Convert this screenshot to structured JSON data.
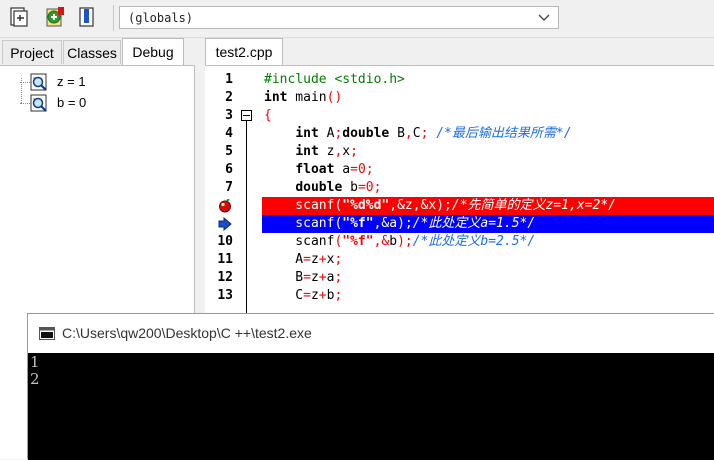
{
  "toolbar": {
    "buttons": [
      {
        "name": "insert-icon"
      },
      {
        "name": "toggle-bookmark-icon"
      },
      {
        "name": "goto-bookmark-icon"
      }
    ],
    "scope_combo": {
      "value": "(globals)"
    }
  },
  "left_panel": {
    "tabs": [
      "Project",
      "Classes",
      "Debug"
    ],
    "active_tab": "Debug",
    "watches": [
      {
        "label": "z = 1"
      },
      {
        "label": "b = 0"
      }
    ]
  },
  "editor": {
    "tab": "test2.cpp",
    "line_numbers": [
      "1",
      "2",
      "3",
      "4",
      "5",
      "6",
      "7",
      "8",
      "9",
      "10",
      "11",
      "12",
      "13"
    ],
    "lines": [
      [
        {
          "c": "pp",
          "t": "#include <stdio.h>"
        }
      ],
      [
        {
          "c": "kw",
          "t": "int"
        },
        {
          "c": "",
          "t": " main"
        },
        {
          "c": "sym",
          "t": "()"
        }
      ],
      [
        {
          "c": "sym",
          "t": "{"
        }
      ],
      [
        {
          "c": "",
          "t": "    "
        },
        {
          "c": "kw",
          "t": "int"
        },
        {
          "c": "",
          "t": " A"
        },
        {
          "c": "sym",
          "t": ";"
        },
        {
          "c": "kw",
          "t": "double"
        },
        {
          "c": "",
          "t": " B"
        },
        {
          "c": "sym",
          "t": ","
        },
        {
          "c": "",
          "t": "C"
        },
        {
          "c": "sym",
          "t": ";"
        },
        {
          "c": "",
          "t": " "
        },
        {
          "c": "cm",
          "t": "/*最后输出结果所需*/"
        }
      ],
      [
        {
          "c": "",
          "t": "    "
        },
        {
          "c": "kw",
          "t": "int"
        },
        {
          "c": "",
          "t": " z"
        },
        {
          "c": "sym",
          "t": ","
        },
        {
          "c": "",
          "t": "x"
        },
        {
          "c": "sym",
          "t": ";"
        }
      ],
      [
        {
          "c": "",
          "t": "    "
        },
        {
          "c": "kw",
          "t": "float"
        },
        {
          "c": "",
          "t": " a"
        },
        {
          "c": "sym",
          "t": "="
        },
        {
          "c": "num",
          "t": "0"
        },
        {
          "c": "sym",
          "t": ";"
        }
      ],
      [
        {
          "c": "",
          "t": "    "
        },
        {
          "c": "kw",
          "t": "double"
        },
        {
          "c": "",
          "t": " b"
        },
        {
          "c": "sym",
          "t": "="
        },
        {
          "c": "num",
          "t": "0"
        },
        {
          "c": "sym",
          "t": ";"
        }
      ],
      [
        {
          "c": "",
          "t": "    scanf"
        },
        {
          "c": "sym",
          "t": "("
        },
        {
          "c": "str",
          "t": "\"%d%d\""
        },
        {
          "c": "sym",
          "t": ",&"
        },
        {
          "c": "",
          "t": "z"
        },
        {
          "c": "sym",
          "t": ",&"
        },
        {
          "c": "",
          "t": "x"
        },
        {
          "c": "sym",
          "t": ");"
        },
        {
          "c": "cm",
          "t": "/*先简单的定义z=1,x=2*/"
        }
      ],
      [
        {
          "c": "",
          "t": "    scanf"
        },
        {
          "c": "sym",
          "t": "("
        },
        {
          "c": "str",
          "t": "\"%f\""
        },
        {
          "c": "sym",
          "t": ",&"
        },
        {
          "c": "",
          "t": "a"
        },
        {
          "c": "sym",
          "t": ");"
        },
        {
          "c": "cm",
          "t": "/*此处定义a=1.5*/"
        }
      ],
      [
        {
          "c": "",
          "t": "    scanf"
        },
        {
          "c": "sym",
          "t": "("
        },
        {
          "c": "str",
          "t": "\"%f\""
        },
        {
          "c": "sym",
          "t": ",&"
        },
        {
          "c": "",
          "t": "b"
        },
        {
          "c": "sym",
          "t": ");"
        },
        {
          "c": "cm",
          "t": "/*此处定义b=2.5*/"
        }
      ],
      [
        {
          "c": "",
          "t": "    A"
        },
        {
          "c": "sym",
          "t": "="
        },
        {
          "c": "",
          "t": "z"
        },
        {
          "c": "sym",
          "t": "+"
        },
        {
          "c": "",
          "t": "x"
        },
        {
          "c": "sym",
          "t": ";"
        }
      ],
      [
        {
          "c": "",
          "t": "    B"
        },
        {
          "c": "sym",
          "t": "="
        },
        {
          "c": "",
          "t": "z"
        },
        {
          "c": "sym",
          "t": "+"
        },
        {
          "c": "",
          "t": "a"
        },
        {
          "c": "sym",
          "t": ";"
        }
      ],
      [
        {
          "c": "",
          "t": "    C"
        },
        {
          "c": "sym",
          "t": "="
        },
        {
          "c": "",
          "t": "z"
        },
        {
          "c": "sym",
          "t": "+"
        },
        {
          "c": "",
          "t": "b"
        },
        {
          "c": "sym",
          "t": ";"
        }
      ]
    ],
    "breakpoint_line": 8,
    "execution_line": 9,
    "colors": {
      "breakpoint": "#ff0000",
      "execution": "#0000ff",
      "comment": "#1e6ee6"
    }
  },
  "console": {
    "title": "C:\\Users\\qw200\\Desktop\\C ++\\test2.exe",
    "output": [
      "1",
      "2"
    ]
  }
}
